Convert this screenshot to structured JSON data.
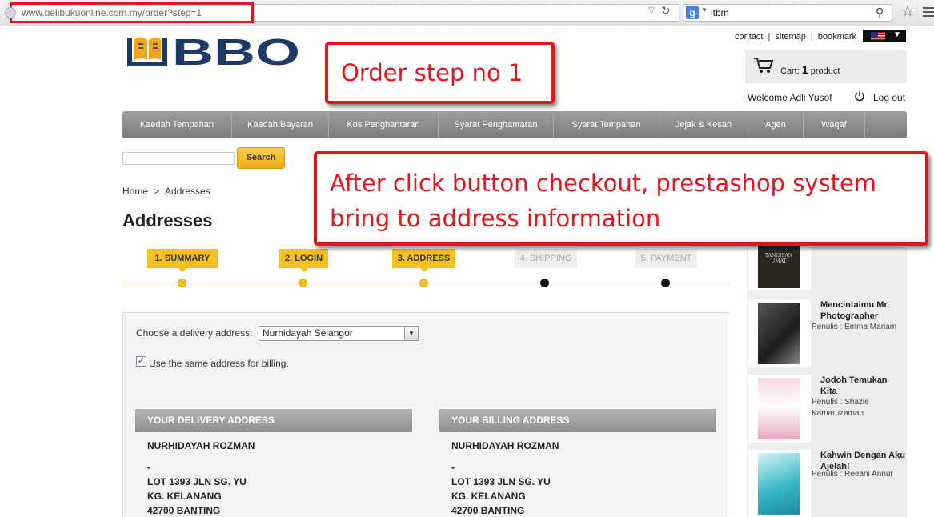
{
  "browser": {
    "url_host": "www.belibukuonline.com.my",
    "url_path": "/order?step=1",
    "search_engine_icon": "g-icon",
    "search_query": "itbm"
  },
  "header": {
    "logo_text": "BBO",
    "top_links": [
      "contact",
      "sitemap",
      "bookmark"
    ],
    "cart_label": "Cart:",
    "cart_count": "1",
    "cart_unit": "product",
    "welcome": "Welcome Adli Yusof",
    "logout": "Log out"
  },
  "nav": {
    "items": [
      "Kaedah Tempahan",
      "Kaedah Bayaran",
      "Kos Penghantaran",
      "Syarat Penghantaran",
      "Syarat Tempahan",
      "Jejak & Kesan",
      "Agen",
      "Waqaf"
    ]
  },
  "search": {
    "button": "Search"
  },
  "breadcrumb": {
    "home": "Home",
    "sep": ">",
    "current": "Addresses"
  },
  "page_title": "Addresses",
  "steps": [
    {
      "label": "1. SUMMARY",
      "state": "done"
    },
    {
      "label": "2. LOGIN",
      "state": "done"
    },
    {
      "label": "3. ADDRESS",
      "state": "current"
    },
    {
      "label": "4. SHIPPING",
      "state": "todo"
    },
    {
      "label": "5. PAYMENT",
      "state": "todo"
    }
  ],
  "address_form": {
    "delivery_label": "Choose a delivery address:",
    "delivery_selected": "Nurhidayah Selangor",
    "same_billing_checked": true,
    "same_billing_label": "Use the same address for billing."
  },
  "delivery_address": {
    "heading": "YOUR DELIVERY ADDRESS",
    "lines": [
      "NURHIDAYAH ROZMAN",
      "-",
      "LOT 1393 JLN SG. YU",
      "KG. KELANANG",
      "42700 BANTING"
    ]
  },
  "billing_address": {
    "heading": "YOUR BILLING ADDRESS",
    "lines": [
      "NURHIDAYAH ROZMAN",
      "-",
      "LOT 1393 JLN SG. YU",
      "KG. KELANANG",
      "42700 BANTING"
    ]
  },
  "books": [
    {
      "title": "",
      "author": "",
      "cover_text": "TANGISAN UMAT",
      "cover_color": "#2b2620"
    },
    {
      "title": "Mencintaimu Mr. Photographer",
      "author": "Penulis : Emma Mariam",
      "cover_color": "#3a3a3a"
    },
    {
      "title": "Jodoh Temukan Kita",
      "author": "Penulis : Shazie Kamaruzaman",
      "cover_color": "#e9b3c9"
    },
    {
      "title": "Kahwin Dengan Aku Ajelah!",
      "author": "Penulis : Reeani Annur",
      "cover_color": "#39b8c7"
    }
  ],
  "annotations": {
    "one": "Order step no 1",
    "two": "After click button checkout, prestashop system bring to address information"
  },
  "colors": {
    "accent_yellow": "#f5c121",
    "annotation_red": "#e8141b",
    "nav_gray": "#8a8a8a",
    "logo_navy": "#1c3968"
  }
}
